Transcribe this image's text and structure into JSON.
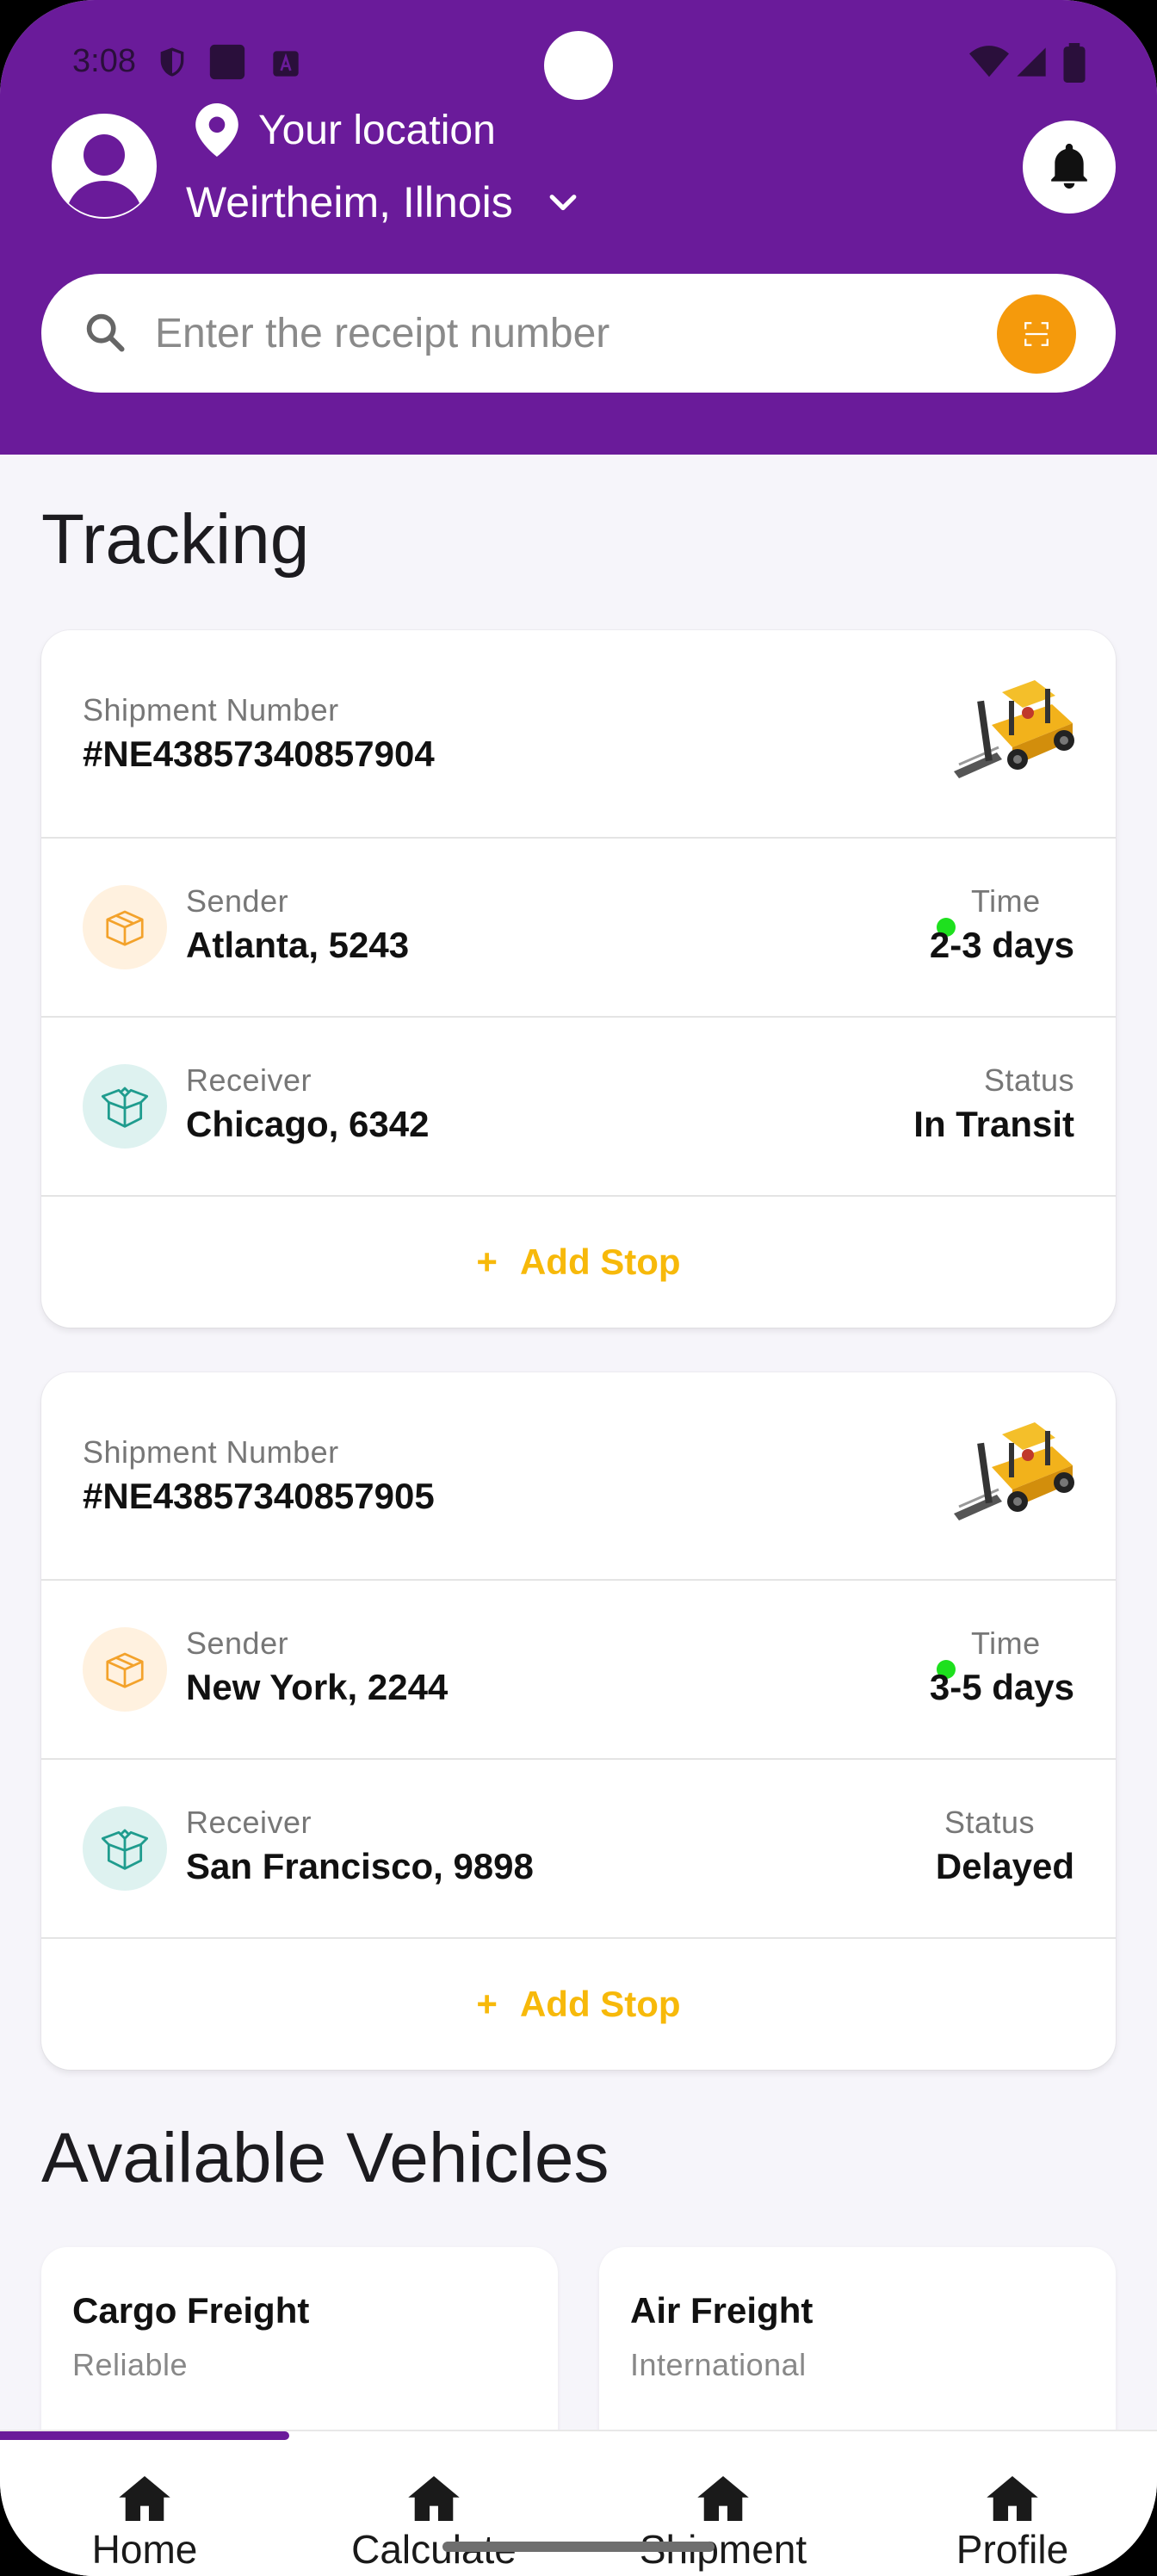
{
  "status_bar": {
    "time": "3:08"
  },
  "header": {
    "location_label": "Your location",
    "location_value": "Weirtheim, Illnois",
    "search_placeholder": "Enter the receipt number"
  },
  "tracking": {
    "title": "Tracking",
    "shipments": [
      {
        "number_label": "Shipment Number",
        "number": "#NE43857340857904",
        "sender_label": "Sender",
        "sender": "Atlanta, 5243",
        "time_label": "Time",
        "time": "2-3 days",
        "receiver_label": "Receiver",
        "receiver": "Chicago, 6342",
        "status_label": "Status",
        "status": "In Transit",
        "add_stop_plus": "+",
        "add_stop": "Add Stop"
      },
      {
        "number_label": "Shipment Number",
        "number": "#NE43857340857905",
        "sender_label": "Sender",
        "sender": "New York, 2244",
        "time_label": "Time",
        "time": "3-5 days",
        "receiver_label": "Receiver",
        "receiver": "San Francisco, 9898",
        "status_label": "Status",
        "status": "Delayed",
        "add_stop_plus": "+",
        "add_stop": "Add Stop"
      }
    ]
  },
  "vehicles": {
    "title": "Available Vehicles",
    "items": [
      {
        "title": "Cargo Freight",
        "subtitle": "Reliable"
      },
      {
        "title": "Air Freight",
        "subtitle": "International"
      }
    ]
  },
  "bottom_nav": {
    "items": [
      {
        "label": "Home",
        "icon": "home-icon",
        "active": true
      },
      {
        "label": "Calculate",
        "icon": "home-icon",
        "active": false
      },
      {
        "label": "Shipment",
        "icon": "home-icon",
        "active": false
      },
      {
        "label": "Profile",
        "icon": "home-icon",
        "active": false
      }
    ]
  },
  "colors": {
    "primary": "#6a1b9a",
    "accent_orange": "#f59a0c",
    "add_stop": "#f7b90a",
    "online_dot": "#1ee01e"
  }
}
